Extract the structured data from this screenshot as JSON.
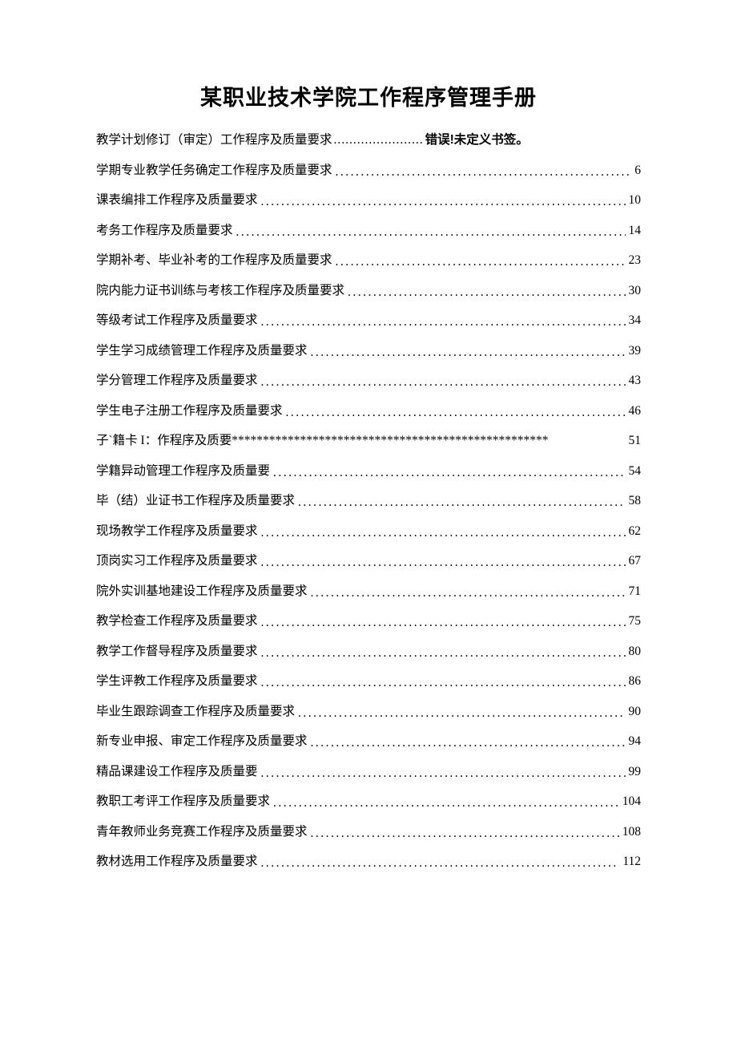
{
  "title": "某职业技术学院工作程序管理手册",
  "error_text": "错误!未定义书签。",
  "short_leader": ".......................",
  "toc": [
    {
      "label": "教学计划修订（审定）工作程序及质量要求",
      "page": "",
      "err": true
    },
    {
      "label": "学期专业教学任务确定工作程序及质量要求",
      "page": "6"
    },
    {
      "label": "课表编排工作程序及质量要求",
      "page": "10"
    },
    {
      "label": "考务工作程序及质量要求",
      "page": "14"
    },
    {
      "label": "学期补考、毕业补考的工作程序及质量要求",
      "page": "23"
    },
    {
      "label": "院内能力证书训练与考核工作程序及质量要求",
      "page": "30"
    },
    {
      "label": "等级考试工作程序及质量要求",
      "page": "34"
    },
    {
      "label": "学生学习成绩管理工作程序及质量要求",
      "page": "39"
    },
    {
      "label": "学分管理工作程序及质量要求",
      "page": "43"
    },
    {
      "label": "学生电子注册工作程序及质量要求",
      "page": "46"
    },
    {
      "label": "子`籍卡 I：作程序及质要",
      "page": "51",
      "stars": true
    },
    {
      "label": "学籍异动管理工作程序及质量要",
      "page": "54"
    },
    {
      "label": "毕（结）业证书工作程序及质量要求",
      "page": "58"
    },
    {
      "label": "现场教学工作程序及质量要求",
      "page": "62"
    },
    {
      "label": "顶岗实习工作程序及质量要求",
      "page": "67"
    },
    {
      "label": "院外实训基地建设工作程序及质量要求",
      "page": "71"
    },
    {
      "label": "教学检查工作程序及质量要求",
      "page": "75"
    },
    {
      "label": "教学工作督导程序及质量要求",
      "page": "80"
    },
    {
      "label": "学生评教工作程序及质量要求",
      "page": "86"
    },
    {
      "label": "毕业生跟踪调查工作程序及质量要求",
      "page": "90"
    },
    {
      "label": "新专业申报、审定工作程序及质量要求",
      "page": "94"
    },
    {
      "label": "精品课建设工作程序及质量要",
      "page": "99"
    },
    {
      "label": "教职工考评工作程序及质量要求",
      "page": "104"
    },
    {
      "label": "青年教师业务竞赛工作程序及质量要求",
      "page": "108"
    },
    {
      "label": "教材选用工作程序及质量要求",
      "page": "112"
    }
  ]
}
